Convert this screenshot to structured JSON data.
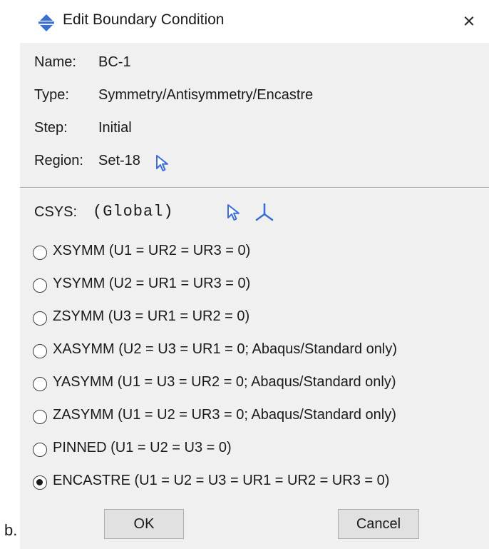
{
  "caption": "b.",
  "dialog": {
    "title": "Edit Boundary Condition",
    "close_label": "×",
    "info": [
      {
        "label": "Name:",
        "value": "BC-1"
      },
      {
        "label": "Type:",
        "value": "Symmetry/Antisymmetry/Encastre"
      },
      {
        "label": "Step:",
        "value": "Initial"
      },
      {
        "label": "Region:",
        "value": "Set-18"
      }
    ],
    "csys": {
      "label": "CSYS:",
      "value": "(Global)"
    },
    "options": [
      {
        "label": "XSYMM (U1 = UR2 = UR3 = 0)",
        "selected": false
      },
      {
        "label": "YSYMM (U2 = UR1 = UR3 = 0)",
        "selected": false
      },
      {
        "label": "ZSYMM (U3 = UR1 = UR2 = 0)",
        "selected": false
      },
      {
        "label": "XASYMM (U2 = U3 = UR1 = 0; Abaqus/Standard only)",
        "selected": false
      },
      {
        "label": "YASYMM (U1 = U3 = UR2 = 0; Abaqus/Standard only)",
        "selected": false
      },
      {
        "label": "ZASYMM (U1 = U2 = UR3 = 0; Abaqus/Standard only)",
        "selected": false
      },
      {
        "label": "PINNED (U1 = U2 = U3 = 0)",
        "selected": false
      },
      {
        "label": "ENCASTRE (U1 = U2 = U3 = UR1 = UR2 = UR3 = 0)",
        "selected": true
      }
    ],
    "ok_label": "OK",
    "cancel_label": "Cancel"
  },
  "icons": {
    "title": "boundary-condition-icon",
    "region_pick": "select-arrow-icon",
    "csys_pick": "select-arrow-icon",
    "csys_create": "axis-triad-icon"
  },
  "colors": {
    "dialog_background": "#f0f0f0",
    "title_bar": "#ffffff",
    "icon_blue": "#3a6fd8",
    "button_face": "#e1e1e1"
  }
}
